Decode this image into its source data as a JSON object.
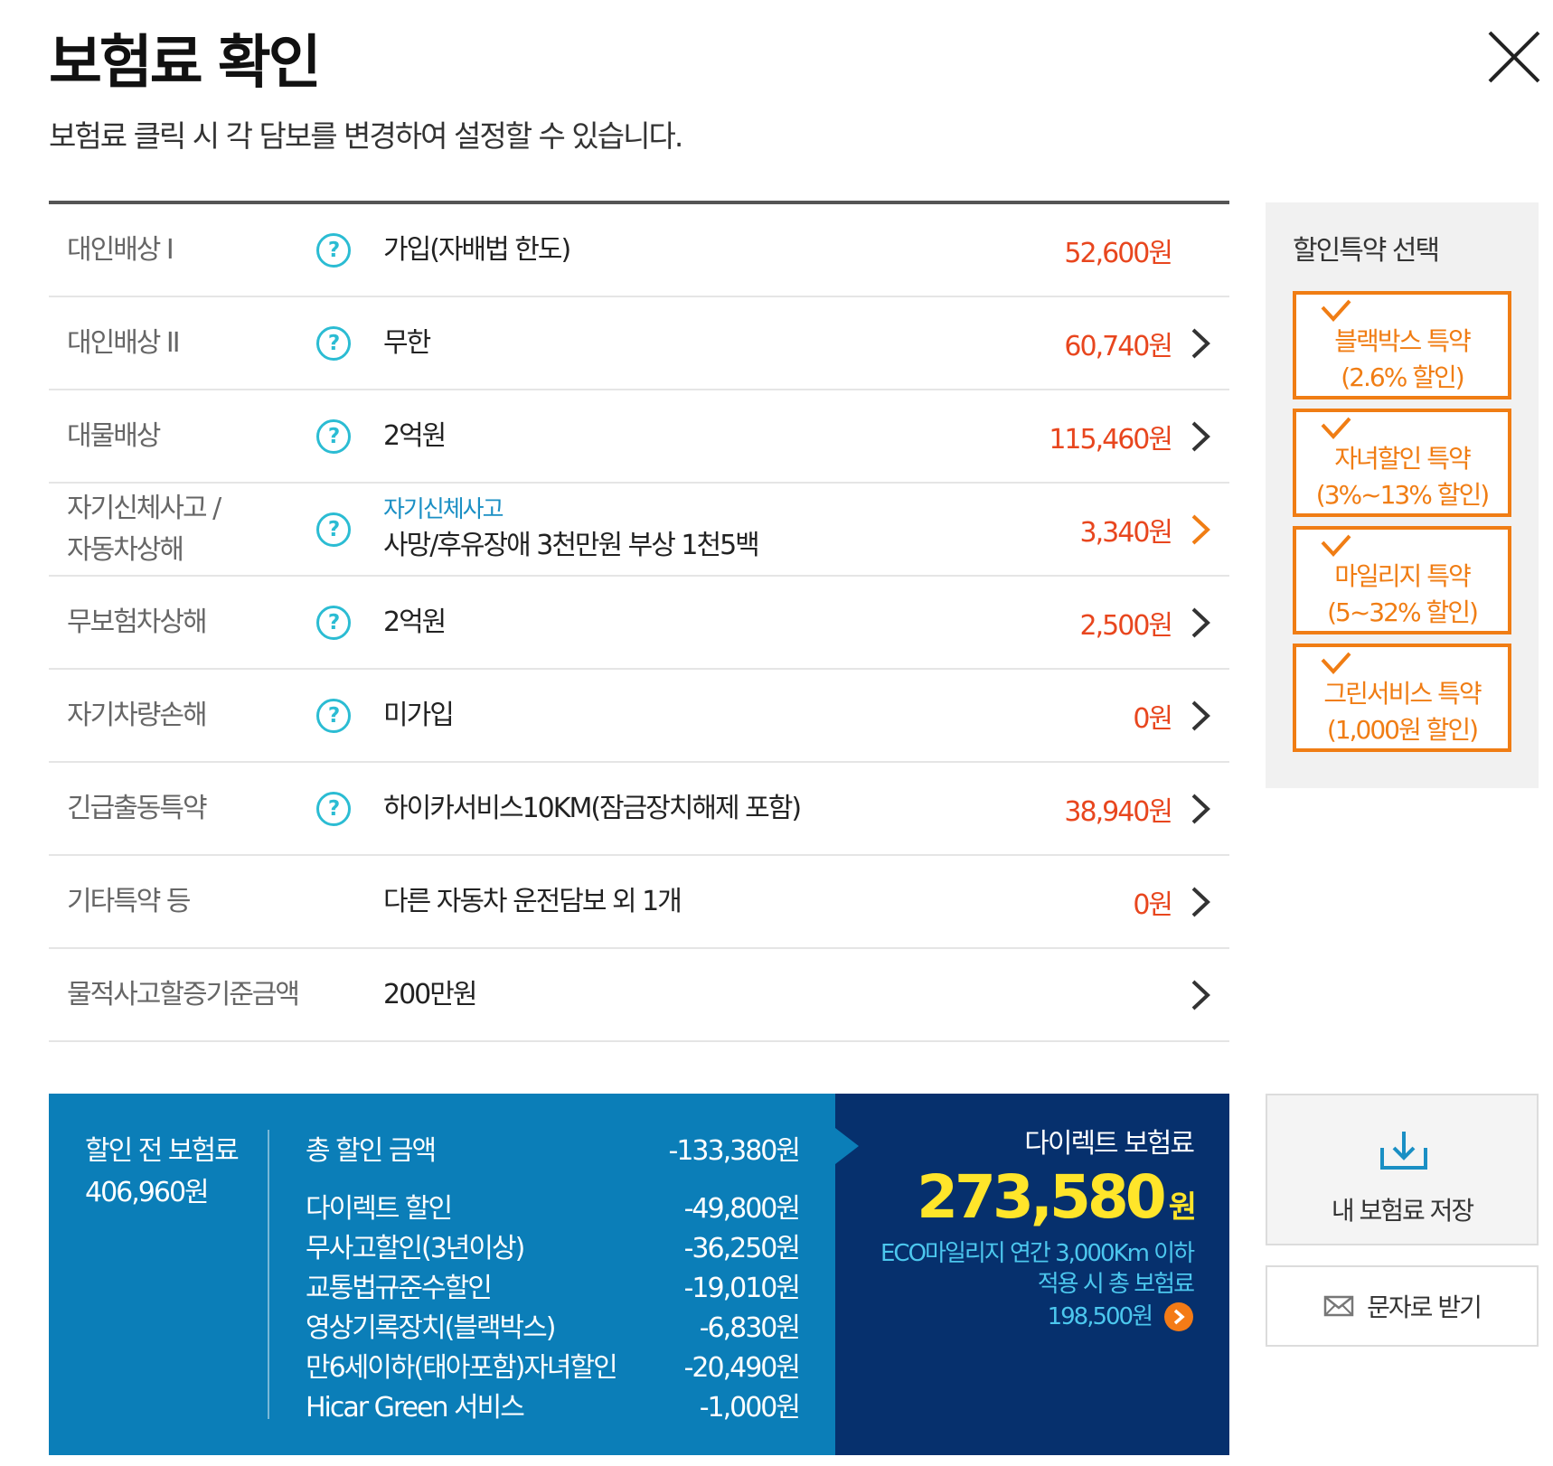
{
  "header": {
    "title": "보험료 확인",
    "subtitle": "보험료 클릭 시 각 담보를 변경하여 설정할 수 있습니다."
  },
  "coverage_rows": [
    {
      "name": "대인배상 I",
      "value": "가입(자배법 한도)",
      "price": "52,600원",
      "has_help": true,
      "has_arrow": false,
      "arrow_color": "#333333"
    },
    {
      "name": "대인배상 II",
      "value": "무한",
      "price": "60,740원",
      "has_help": true,
      "has_arrow": true,
      "arrow_color": "#333333"
    },
    {
      "name": "대물배상",
      "value": "2억원",
      "price": "115,460원",
      "has_help": true,
      "has_arrow": true,
      "arrow_color": "#333333"
    },
    {
      "name_line1": "자기신체사고 /",
      "name_line2": "자동차상해",
      "value_link": "자기신체사고",
      "value": "사망/후유장애 3천만원 부상 1천5백",
      "price": "3,340원",
      "has_help": true,
      "has_arrow": true,
      "arrow_color": "#f07d14"
    },
    {
      "name": "무보험차상해",
      "value": "2억원",
      "price": "2,500원",
      "has_help": true,
      "has_arrow": true,
      "arrow_color": "#333333"
    },
    {
      "name": "자기차량손해",
      "value": "미가입",
      "price": "0원",
      "has_help": true,
      "has_arrow": true,
      "arrow_color": "#333333"
    },
    {
      "name": "긴급출동특약",
      "value": "하이카서비스10KM(잠금장치해제 포함)",
      "price": "38,940원",
      "has_help": true,
      "has_arrow": true,
      "arrow_color": "#333333"
    },
    {
      "name": "기타특약 등",
      "value": "다른 자동차 운전담보 외 1개",
      "price": "0원",
      "has_help": false,
      "has_arrow": true,
      "arrow_color": "#333333"
    },
    {
      "name": "물적사고할증기준금액",
      "value": "200만원",
      "price": "",
      "has_help": false,
      "has_arrow": true,
      "arrow_color": "#333333"
    }
  ],
  "discount_panel": {
    "title": "할인특약 선택",
    "items": [
      {
        "line1": "블랙박스 특약",
        "line2": "(2.6% 할인)",
        "checked": true
      },
      {
        "line1": "자녀할인 특약",
        "line2": "(3%~13% 할인)",
        "checked": true
      },
      {
        "line1": "마일리지 특약",
        "line2": "(5~32% 할인)",
        "checked": true
      },
      {
        "line1": "그린서비스 특약",
        "line2": "(1,000원 할인)",
        "checked": true
      }
    ]
  },
  "summary": {
    "before_label": "할인 전 보험료",
    "before_value": "406,960원",
    "total_discount_label": "총 할인 금액",
    "total_discount_value": "-133,380원",
    "discounts": [
      {
        "label": "다이렉트 할인",
        "value": "-49,800원"
      },
      {
        "label": "무사고할인(3년이상)",
        "value": "-36,250원"
      },
      {
        "label": "교통법규준수할인",
        "value": "-19,010원"
      },
      {
        "label": "영상기록장치(블랙박스)",
        "value": "-6,830원"
      },
      {
        "label": "만6세이하(태아포함)자녀할인",
        "value": "-20,490원"
      },
      {
        "label": "Hicar Green 서비스",
        "value": "-1,000원"
      }
    ],
    "direct_label": "다이렉트 보험료",
    "direct_value": "273,580",
    "direct_unit": "원",
    "eco_line1": "ECO마일리지 연간 3,000Km 이하",
    "eco_line2": "적용 시 총 보험료",
    "eco_value": "198,500원"
  },
  "actions": {
    "save_label": "내 보험료 저장",
    "sms_label": "문자로 받기"
  },
  "icons": {
    "close": "close-icon",
    "help": "question-icon",
    "arrow": "chevron-right-icon",
    "check": "check-icon",
    "download": "download-icon",
    "mail": "mail-icon",
    "go": "arrow-circle-icon"
  },
  "colors": {
    "price": "#e8461e",
    "accent_orange": "#f07d14",
    "help_teal": "#2bbcd3",
    "summary_blue": "#0b7eb8",
    "summary_navy": "#06306d",
    "direct_yellow": "#ffe52a",
    "eco_cyan": "#4cc7ee"
  }
}
